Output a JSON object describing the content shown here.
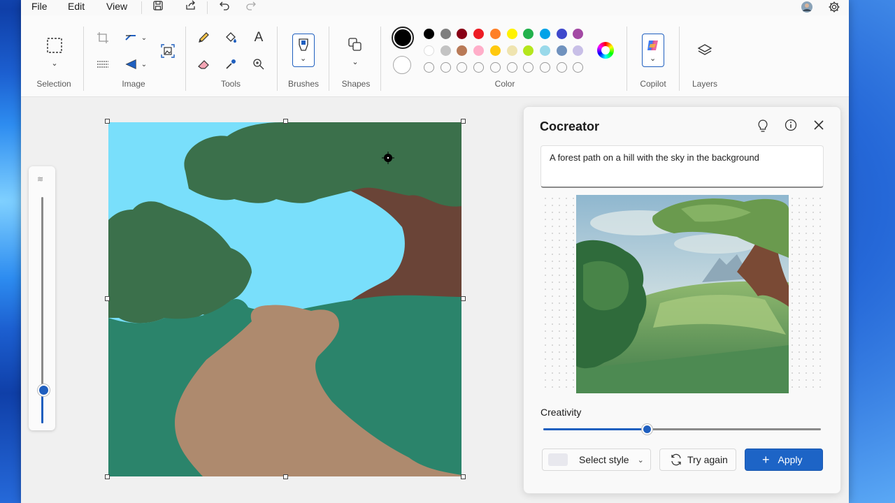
{
  "menubar": {
    "file": "File",
    "edit": "Edit",
    "view": "View"
  },
  "ribbon": {
    "selection_label": "Selection",
    "image_label": "Image",
    "tools_label": "Tools",
    "brushes_label": "Brushes",
    "shapes_label": "Shapes",
    "color_label": "Color",
    "copilot_label": "Copilot",
    "layers_label": "Layers"
  },
  "palette": {
    "primary": "#000000",
    "secondary": "#ffffff",
    "row1": [
      "#000000",
      "#7f7f7f",
      "#880015",
      "#ed1c24",
      "#ff7f27",
      "#fff200",
      "#22b14c",
      "#00a2e8",
      "#3f48cc",
      "#a349a4"
    ],
    "row2": [
      "#ffffff",
      "#c3c3c3",
      "#b97a57",
      "#ffaec9",
      "#ffc90e",
      "#efe4b0",
      "#b5e61d",
      "#99d9ea",
      "#7092be",
      "#c8bfe7"
    ]
  },
  "cocreator": {
    "title": "Cocreator",
    "prompt": "A forest path on a hill with the sky in the background",
    "creativity_label": "Creativity",
    "creativity_value": 0.37,
    "select_style": "Select style",
    "try_again": "Try again",
    "apply": "Apply"
  },
  "zoom": {
    "value": 0.15
  }
}
